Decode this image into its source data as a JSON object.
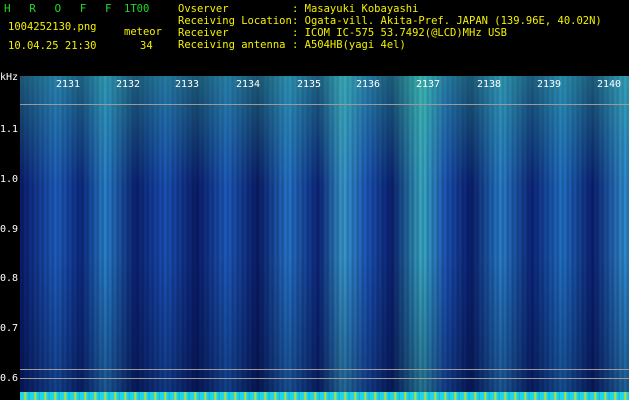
{
  "header": {
    "app_title": "H R O F F T",
    "version": "1.00",
    "file_name": "1004252130.png",
    "meteor_label": "meteor",
    "datetime": "10.04.25 21:30",
    "meteor_count": "34",
    "info": [
      {
        "label": "Ovserver",
        "value": ": Masayuki Kobayashi"
      },
      {
        "label": "Receiving Location",
        "value": ": Ogata-vill. Akita-Pref. JAPAN (139.96E, 40.02N)"
      },
      {
        "label": "Receiver",
        "value": ": ICOM IC-575 53.7492(@LCD)MHz USB"
      },
      {
        "label": "Receiving antenna",
        "value": ": A504HB(yagi 4el)"
      }
    ]
  },
  "axis": {
    "y_unit": "kHz",
    "y_ticks": [
      "1.1",
      "1.0",
      "0.9",
      "0.8",
      "0.7",
      "0.6"
    ],
    "x_ticks": [
      "2131",
      "2132",
      "2133",
      "2134",
      "2135",
      "2136",
      "2137",
      "2138",
      "2139",
      "2140"
    ]
  },
  "colors": {
    "label_green": "#23d62a",
    "label_yellow": "#f3f100",
    "spectrum_blue": "#1f61c8"
  }
}
